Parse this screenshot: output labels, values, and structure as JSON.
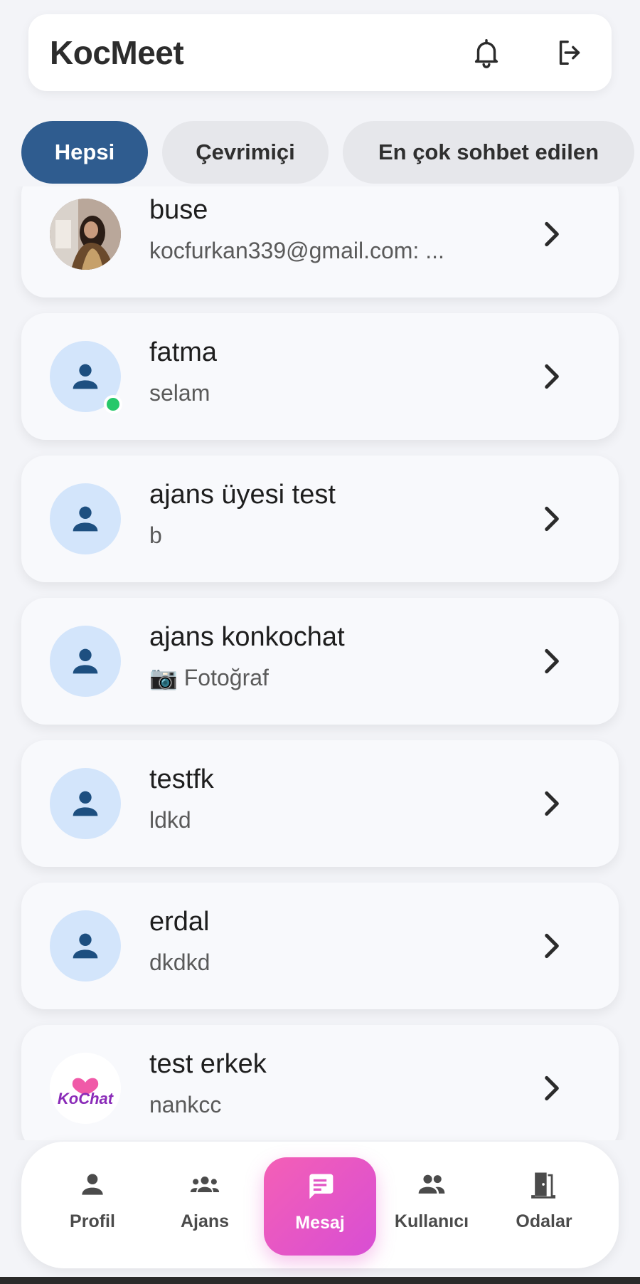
{
  "header": {
    "title": "KocMeet",
    "icons": [
      "bell-icon",
      "logout-icon"
    ]
  },
  "filters": {
    "tabs": [
      {
        "label": "Hepsi",
        "active": true
      },
      {
        "label": "Çevrimiçi",
        "active": false
      },
      {
        "label": "En çok sohbet edilen",
        "active": false
      }
    ]
  },
  "chats": [
    {
      "name": "buse",
      "last_message": "kocfurkan339@gmail.com: ...",
      "avatar": "photo-avatar",
      "online": false
    },
    {
      "name": "fatma",
      "last_message": "selam",
      "avatar": "person-icon",
      "online": true
    },
    {
      "name": "ajans üyesi test",
      "last_message": "b",
      "avatar": "person-icon",
      "online": false
    },
    {
      "name": "ajans konkochat",
      "last_message": "📷 Fotoğraf",
      "avatar": "person-icon",
      "online": false
    },
    {
      "name": "testfk",
      "last_message": "ldkd",
      "avatar": "person-icon",
      "online": false
    },
    {
      "name": "erdal",
      "last_message": "dkdkd",
      "avatar": "person-icon",
      "online": false
    },
    {
      "name": "test erkek",
      "last_message": "nankcc",
      "avatar": "kochat-logo",
      "online": false
    }
  ],
  "logo_text": "KoChat",
  "bottom_nav": {
    "items": [
      {
        "label": "Profil",
        "icon": "person-icon",
        "active": false
      },
      {
        "label": "Ajans",
        "icon": "group-icon",
        "active": false
      },
      {
        "label": "Mesaj",
        "icon": "message-icon",
        "active": true
      },
      {
        "label": "Kullanıcı",
        "icon": "users-icon",
        "active": false
      },
      {
        "label": "Odalar",
        "icon": "door-icon",
        "active": false
      }
    ]
  },
  "colors": {
    "accent": "#2f5c8f",
    "avatar_bg": "#d3e5fb",
    "person_icon": "#1d4f80",
    "online": "#26c86a",
    "active_nav": "#e957c6"
  }
}
